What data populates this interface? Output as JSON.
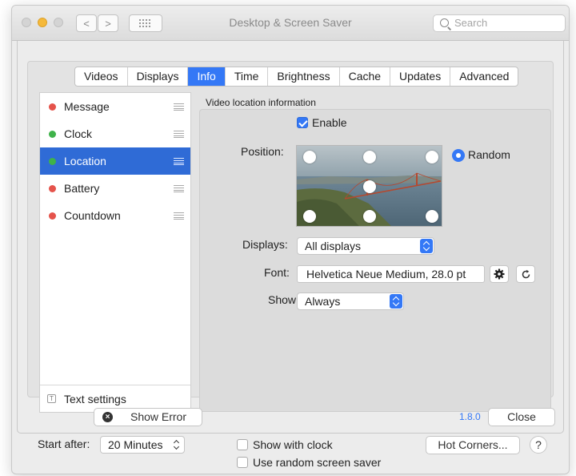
{
  "window": {
    "title": "Desktop & Screen Saver",
    "search_placeholder": "Search",
    "back_label": "<",
    "forward_label": ">"
  },
  "tabs": [
    "Videos",
    "Displays",
    "Info",
    "Time",
    "Brightness",
    "Cache",
    "Updates",
    "Advanced"
  ],
  "active_tab": "Info",
  "info_list": {
    "items": [
      {
        "label": "Message",
        "status_color": "#e5534b",
        "selected": false
      },
      {
        "label": "Clock",
        "status_color": "#3fb24a",
        "selected": false
      },
      {
        "label": "Location",
        "status_color": "#3fb24a",
        "selected": true
      },
      {
        "label": "Battery",
        "status_color": "#e5534b",
        "selected": false
      },
      {
        "label": "Countdown",
        "status_color": "#e5534b",
        "selected": false
      }
    ],
    "footer_label": "Text settings",
    "footer_icon": "T"
  },
  "location_panel": {
    "group_label": "Video location information",
    "enable_label": "Enable",
    "enable_checked": true,
    "position_label": "Position:",
    "random_label": "Random",
    "random_selected": true,
    "displays_label": "Displays:",
    "displays_value": "All displays",
    "font_label": "Font:",
    "font_value": "Helvetica Neue Medium, 28.0 pt",
    "show_label": "Show:",
    "show_value": "Always"
  },
  "sheet_footer": {
    "show_error_label": "Show Error",
    "version": "1.8.0",
    "close_label": "Close"
  },
  "bottom_bar": {
    "start_after_label": "Start after:",
    "start_after_value": "20 Minutes",
    "show_with_clock_label": "Show with clock",
    "random_saver_label": "Use random screen saver",
    "hot_corners_label": "Hot Corners...",
    "help_label": "?"
  },
  "colors": {
    "accent": "#3478f6",
    "selection": "#2f6bd6",
    "status_red": "#e5534b",
    "status_green": "#3fb24a",
    "version_text": "#3478f6"
  }
}
